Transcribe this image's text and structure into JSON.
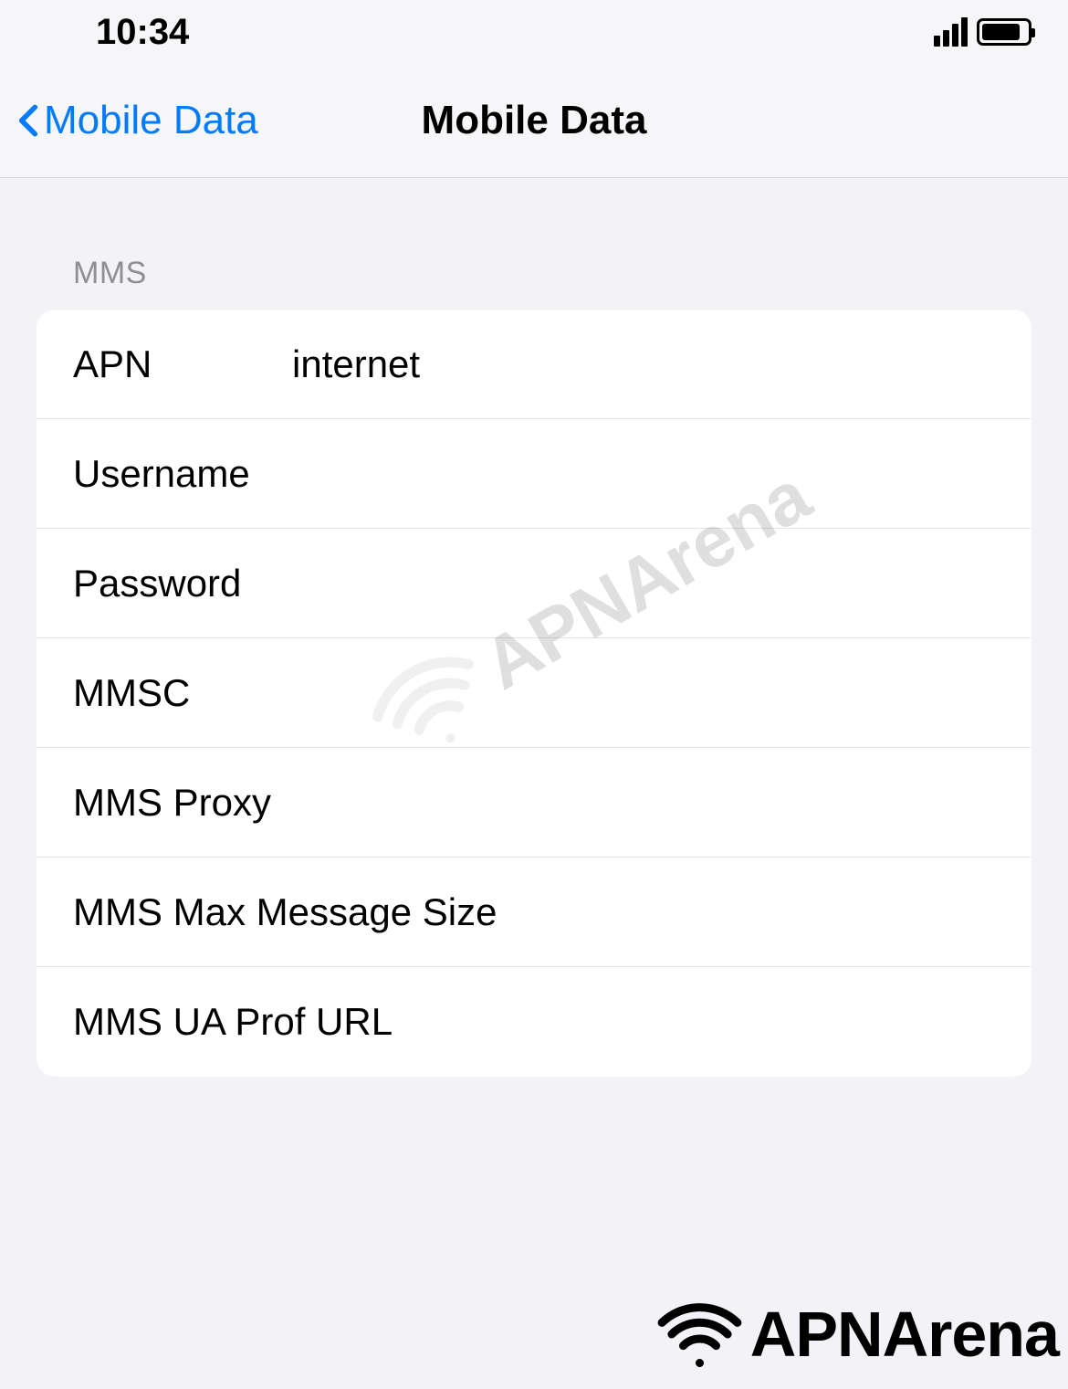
{
  "status": {
    "time": "10:34"
  },
  "nav": {
    "back_label": "Mobile Data",
    "title": "Mobile Data"
  },
  "section": {
    "header": "MMS",
    "rows": [
      {
        "label": "APN",
        "value": "internet"
      },
      {
        "label": "Username",
        "value": ""
      },
      {
        "label": "Password",
        "value": ""
      },
      {
        "label": "MMSC",
        "value": ""
      },
      {
        "label": "MMS Proxy",
        "value": ""
      },
      {
        "label": "MMS Max Message Size",
        "value": ""
      },
      {
        "label": "MMS UA Prof URL",
        "value": ""
      }
    ]
  },
  "watermark": "APNArena"
}
